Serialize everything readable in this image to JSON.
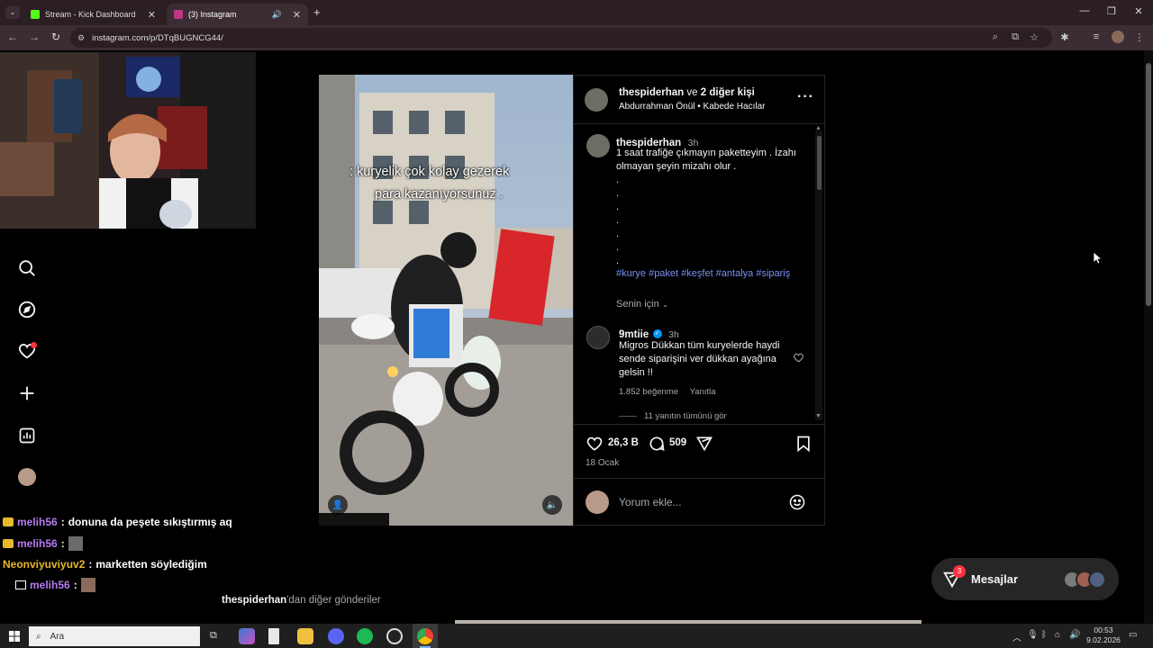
{
  "browser": {
    "tabs": [
      {
        "title": "Stream - Kick Dashboard",
        "favicon_color": "#53fc18"
      },
      {
        "title": "(3) Instagram",
        "favicon_color": "#c13584"
      }
    ],
    "url": "instagram.com/p/DTqBUGNCG44/"
  },
  "instagram": {
    "post": {
      "header": {
        "username": "thespiderhan",
        "with_text": "ve",
        "others": "2 diğer kişi",
        "subtitle": "Abdurrahman Önül • Kabede Hacılar"
      },
      "video_overlay": {
        "line1": ": kuryelik çok kolay gezerek",
        "line2": "para kazanıyorsunuz ."
      },
      "caption": {
        "username": "thespiderhan",
        "time": "3h",
        "text": "1 saat trafiğe çıkmayın paketteyim . İzahı olmayan şeyin mizahı olur .",
        "dots": [
          ".",
          ".",
          ".",
          ".",
          ".",
          ".",
          "."
        ],
        "hashtags": "#kurye #paket #keşfet #antalya #sipariş"
      },
      "for_you": "Senin için",
      "comment": {
        "username": "9mtiie",
        "time": "3h",
        "text": "Migros Dükkan tüm kuryelerde haydi sende siparişini ver dükkan ayağına gelsin !!",
        "likes": "1.852 beğenme",
        "reply": "Yanıtla",
        "view_replies": "11 yanıtın tümünü gör"
      },
      "actions": {
        "likes": "26,3 B",
        "comments": "509"
      },
      "date": "18 Ocak",
      "comment_placeholder": "Yorum ekle..."
    },
    "more_posts": {
      "username": "thespiderhan",
      "suffix": "'dan diğer gönderiler"
    },
    "messages": {
      "label": "Mesajlar",
      "badge": "3"
    }
  },
  "chat": [
    {
      "user": "melih56",
      "sep": ":",
      "text": "donuna da peşete sıkıştırmış aq",
      "color": "#b57bf0"
    },
    {
      "user": "melih56",
      "sep": ":",
      "text": "",
      "color": "#b57bf0"
    },
    {
      "user": "Neonviyuviyuv2",
      "sep": ":",
      "text": "marketten söylediğim",
      "color": "#e7b92b"
    },
    {
      "user": "melih56",
      "sep": ":",
      "text": "",
      "color": "#b57bf0"
    }
  ],
  "taskbar": {
    "search": "Ara",
    "time": "00:53",
    "date": "9.02.2026"
  }
}
